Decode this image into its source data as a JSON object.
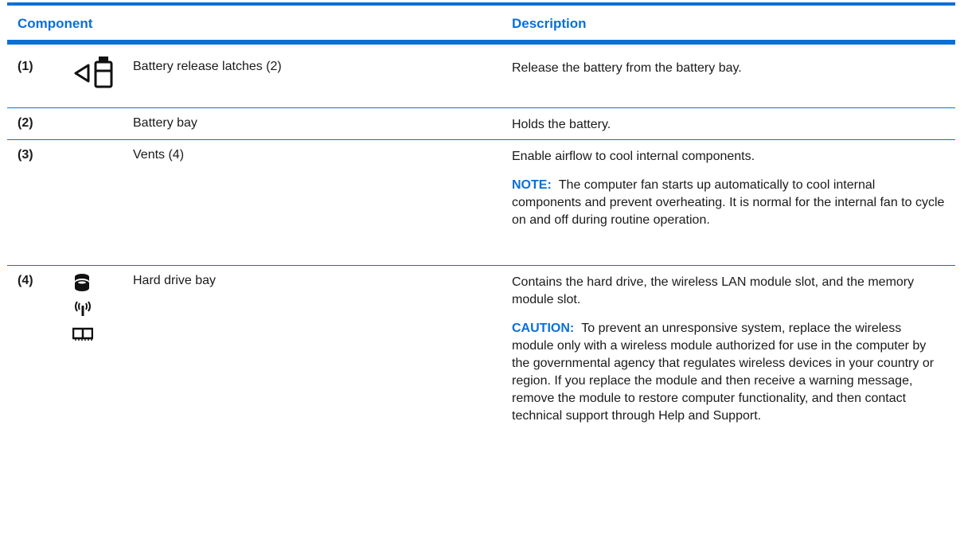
{
  "header": {
    "component": "Component",
    "description": "Description"
  },
  "rows": [
    {
      "number": "(1)",
      "name": "Battery release latches (2)",
      "description": [
        "Release the battery from the battery bay."
      ],
      "icons": [
        "battery-release-icon"
      ]
    },
    {
      "number": "(2)",
      "name": "Battery bay",
      "description": [
        "Holds the battery."
      ]
    },
    {
      "number": "(3)",
      "name": "Vents (4)",
      "description": [
        "Enable airflow to cool internal components."
      ],
      "note": {
        "label": "NOTE:",
        "text": "The computer fan starts up automatically to cool internal components and prevent overheating. It is normal for the internal fan to cycle on and off during routine operation."
      }
    },
    {
      "number": "(4)",
      "name": "Hard drive bay",
      "description": [
        "Contains the hard drive, the wireless LAN module slot, and the memory module slot."
      ],
      "note": {
        "label": "CAUTION:",
        "text": "To prevent an unresponsive system, replace the wireless module only with a wireless module authorized for use in the computer by the governmental agency that regulates wireless devices in your country or region. If you replace the module and then receive a warning message, remove the module to restore computer functionality, and then contact technical support through Help and Support."
      },
      "icons": [
        "hard-drive-icon",
        "wireless-icon",
        "memory-module-icon"
      ]
    }
  ],
  "colors": {
    "accent": "#0b6fd6",
    "text": "#1a1a1a"
  }
}
